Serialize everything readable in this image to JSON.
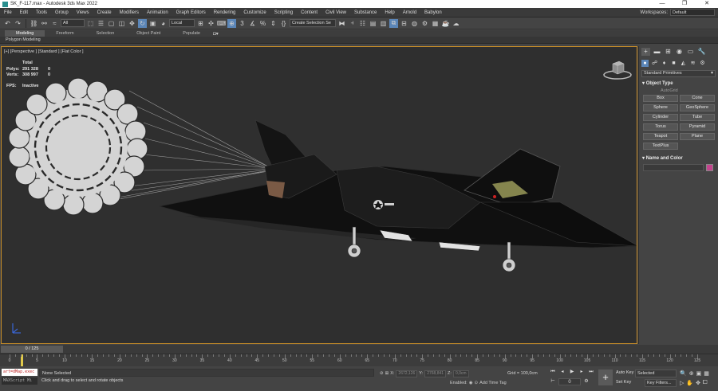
{
  "window": {
    "title": "SK_F-117.max - Autodesk 3ds Max 2022",
    "buttons": [
      "—",
      "❐",
      "✕"
    ]
  },
  "menu": {
    "items": [
      "File",
      "Edit",
      "Tools",
      "Group",
      "Views",
      "Create",
      "Modifiers",
      "Animation",
      "Graph Editors",
      "Rendering",
      "Customize",
      "Scripting",
      "Content",
      "Civil View",
      "Substance",
      "Help",
      "Arnold",
      "Babylon"
    ],
    "workspaces_label": "Workspaces:",
    "workspaces_value": "Default"
  },
  "toolbar": {
    "filter_value": "All",
    "coord_value": "Local",
    "selection_set_placeholder": "Create Selection Se"
  },
  "ribbon": {
    "tabs": [
      "Modeling",
      "Freeform",
      "Selection",
      "Object Paint",
      "Populate"
    ],
    "active_tab": "Modeling",
    "sub_label": "Polygon Modeling"
  },
  "viewport": {
    "label": "[+] [Perspective ] [Standard ] [Flat Color ]",
    "stats": {
      "header": "Total",
      "polys_label": "Polys:",
      "polys_value": "291 328",
      "polys_extra": "0",
      "verts_label": "Verts:",
      "verts_value": "308 997",
      "verts_extra": "0",
      "fps_label": "FPS:",
      "fps_value": "Inactive"
    }
  },
  "command_panel": {
    "dropdown": "Standard Primitives",
    "object_type_title": "Object Type",
    "autogrid": "AutoGrid",
    "buttons": [
      "Box",
      "Cone",
      "Sphere",
      "GeoSphere",
      "Cylinder",
      "Tube",
      "Torus",
      "Pyramid",
      "Teapot",
      "Plane",
      "TextPlus"
    ],
    "name_color_title": "Name and Color",
    "color_swatch": "#c4448e"
  },
  "timeline": {
    "slider_label": "0 / 125",
    "ticks": [
      0,
      5,
      10,
      15,
      20,
      25,
      30,
      35,
      40,
      45,
      50,
      55,
      60,
      65,
      70,
      75,
      80,
      85,
      90,
      95,
      100,
      105,
      110,
      115,
      120,
      125
    ]
  },
  "status": {
    "maxscript_top": "art=dMap.exec",
    "maxscript_bottom": "MAXScript Mi",
    "selection": "None Selected",
    "prompt": "Click and drag to select and rotate objects",
    "x_label": "X:",
    "x_value": "2672,126",
    "y_label": "Y:",
    "y_value": "2768,841",
    "z_label": "Z:",
    "z_value": "0,0cm",
    "grid": "Grid = 100,0cm",
    "enabled": "Enabled:",
    "add_time_tag": "Add Time Tag",
    "auto_key": "Auto Key",
    "selected": "Selected",
    "set_key": "Set Key",
    "key_filters": "Key Filters...",
    "frame_value": "0"
  }
}
